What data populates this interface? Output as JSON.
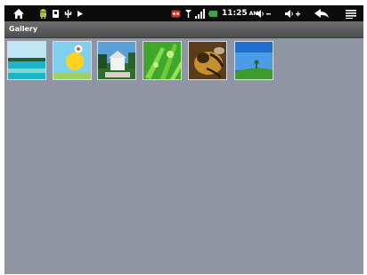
{
  "app": {
    "title": "Gallery"
  },
  "status_bar": {
    "time": "11:25",
    "ampm": "AM",
    "icons": [
      "home-icon",
      "android-robot-icon",
      "usb-icon",
      "usb-debug-icon",
      "play-store-icon",
      "alert-icon",
      "signal-icon",
      "wifi-icon",
      "battery-icon",
      "volume-down-icon",
      "volume-up-icon",
      "back-icon",
      "menu-icon"
    ]
  },
  "gallery": {
    "items": [
      {
        "name": "beach-lagoon"
      },
      {
        "name": "cartoon-sun"
      },
      {
        "name": "white-pavilion"
      },
      {
        "name": "green-leaves"
      },
      {
        "name": "bee-close-up"
      },
      {
        "name": "green-hills-sky"
      }
    ]
  },
  "colors": {
    "background": "#8f95a3",
    "status_bar": "#0b0b0b",
    "title_bar": "#5e5e5e"
  }
}
